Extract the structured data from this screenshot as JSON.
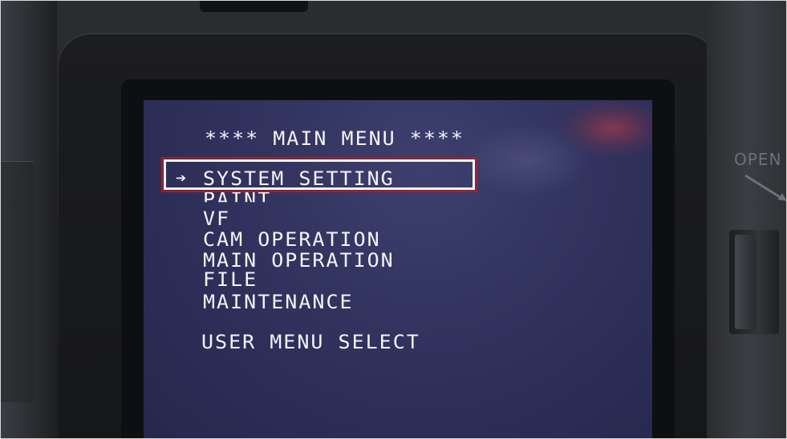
{
  "screen": {
    "title": "**** MAIN MENU ****",
    "cursor": "➔",
    "items": [
      {
        "label": "SYSTEM SETTING",
        "selected": true
      },
      {
        "label": "PAINT"
      },
      {
        "label": "VF"
      },
      {
        "label": "CAM OPERATION"
      },
      {
        "label": "MAIN OPERATION"
      },
      {
        "label": "FILE"
      },
      {
        "label": "MAINTENANCE"
      }
    ],
    "user_menu": "USER MENU SELECT"
  },
  "camera": {
    "open_label": "OPEN"
  },
  "colors": {
    "screen_bg": "#32345f",
    "text": "#f3f3f8",
    "highlight_outer": "#b11b1e",
    "highlight_inner": "#f4f4f6"
  }
}
